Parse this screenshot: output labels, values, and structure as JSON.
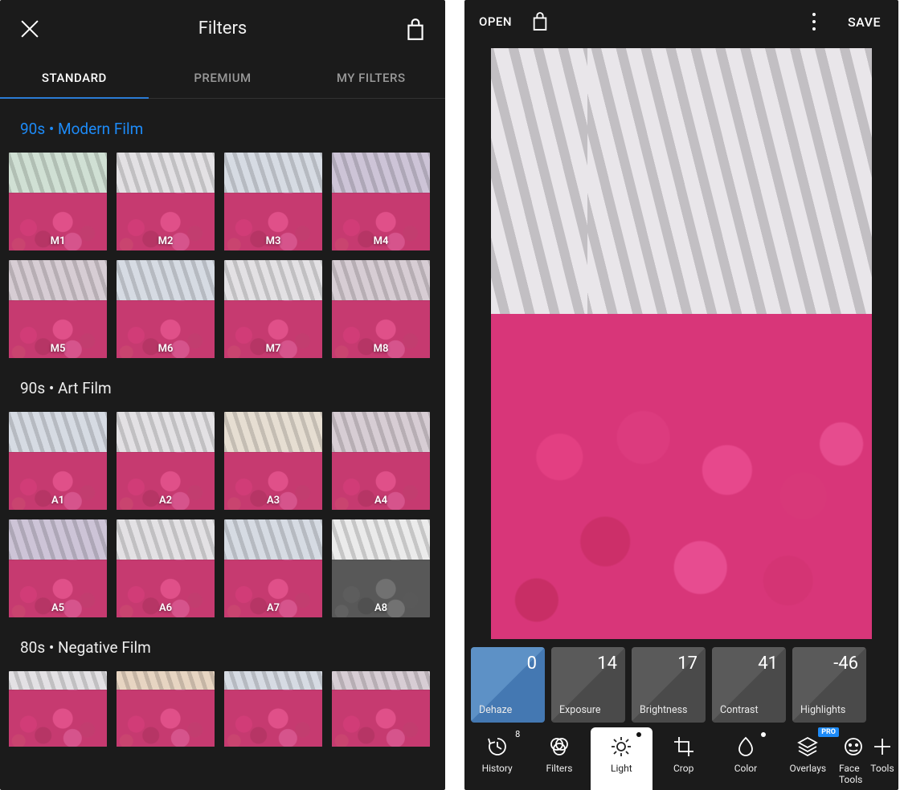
{
  "left": {
    "title": "Filters",
    "tabs": [
      {
        "label": "STANDARD",
        "active": true
      },
      {
        "label": "PREMIUM",
        "active": false
      },
      {
        "label": "MY FILTERS",
        "active": false
      }
    ],
    "sections": [
      {
        "title": "90s • Modern Film",
        "accent": true,
        "items": [
          {
            "label": "M1",
            "wall": "w-green"
          },
          {
            "label": "M2",
            "wall": "wall-base"
          },
          {
            "label": "M3",
            "wall": "w-cool"
          },
          {
            "label": "M4",
            "wall": "w-purple"
          },
          {
            "label": "M5",
            "wall": "w-muted"
          },
          {
            "label": "M6",
            "wall": "w-cool"
          },
          {
            "label": "M7",
            "wall": "wall-base"
          },
          {
            "label": "M8",
            "wall": "w-muted"
          }
        ]
      },
      {
        "title": "90s • Art Film",
        "accent": false,
        "items": [
          {
            "label": "A1",
            "wall": "w-cool"
          },
          {
            "label": "A2",
            "wall": "wall-base"
          },
          {
            "label": "A3",
            "wall": "w-warm"
          },
          {
            "label": "A4",
            "wall": "w-muted"
          },
          {
            "label": "A5",
            "wall": "w-purple"
          },
          {
            "label": "A6",
            "wall": "wall-base"
          },
          {
            "label": "A7",
            "wall": "w-cool"
          },
          {
            "label": "A8",
            "wall": "w-bw wall-base"
          }
        ]
      },
      {
        "title": "80s • Negative Film",
        "accent": false,
        "crop": true,
        "items": [
          {
            "label": "",
            "wall": "wall-base"
          },
          {
            "label": "",
            "wall": "w-orange"
          },
          {
            "label": "",
            "wall": "w-cool"
          },
          {
            "label": "",
            "wall": "w-muted"
          }
        ]
      }
    ]
  },
  "right": {
    "open": "OPEN",
    "save": "SAVE",
    "adjustments": [
      {
        "name": "Dehaze",
        "value": "0",
        "active": true
      },
      {
        "name": "Exposure",
        "value": "14",
        "active": false
      },
      {
        "name": "Brightness",
        "value": "17",
        "active": false
      },
      {
        "name": "Contrast",
        "value": "41",
        "active": false
      },
      {
        "name": "Highlights",
        "value": "-46",
        "active": false
      }
    ],
    "nav": [
      {
        "label": "History",
        "icon": "history",
        "count": "8"
      },
      {
        "label": "Filters",
        "icon": "filters"
      },
      {
        "label": "Light",
        "icon": "light",
        "active": true,
        "dot": true
      },
      {
        "label": "Crop",
        "icon": "crop"
      },
      {
        "label": "Color",
        "icon": "color",
        "dot_edit": true
      },
      {
        "label": "Overlays",
        "icon": "overlays",
        "pro": "PRO"
      },
      {
        "label": "Face Tools",
        "icon": "face",
        "cut": true
      },
      {
        "label": "Tools",
        "icon": "tools",
        "cut": true
      }
    ]
  }
}
